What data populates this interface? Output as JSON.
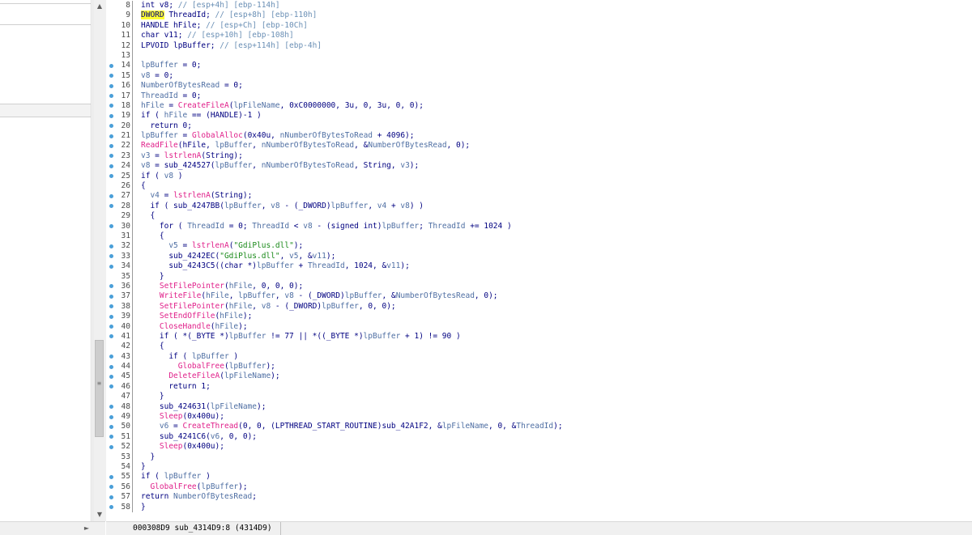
{
  "left_scrollbar": {
    "up_arrow": "▲",
    "down_arrow": "▼",
    "grip": "≡"
  },
  "bottom_left": {
    "right_arrow": "►"
  },
  "status_bar": {
    "text": "000308D9 sub_4314D9:8 (4314D9)"
  },
  "colors": {
    "keyword": "#000080",
    "comment": "#6a8fb5",
    "api": "#e0208a",
    "variable": "#4f6fa3",
    "string": "#1a8a1a",
    "highlight": "#ffff33",
    "dot": "#4a9fd8"
  },
  "code_lines": [
    {
      "n": "8",
      "dot": false,
      "parts": [
        [
          "kw",
          "int v8; "
        ],
        [
          "cm",
          "// [esp+4h] [ebp-114h]"
        ]
      ]
    },
    {
      "n": "9",
      "dot": false,
      "parts": [
        [
          "hl",
          "DWORD"
        ],
        [
          "kw",
          " ThreadId; "
        ],
        [
          "cm",
          "// [esp+8h] [ebp-110h]"
        ]
      ]
    },
    {
      "n": "10",
      "dot": false,
      "parts": [
        [
          "kw",
          "HANDLE hFile; "
        ],
        [
          "cm",
          "// [esp+Ch] [ebp-10Ch]"
        ]
      ]
    },
    {
      "n": "11",
      "dot": false,
      "parts": [
        [
          "kw",
          "char v11; "
        ],
        [
          "cm",
          "// [esp+10h] [ebp-108h]"
        ]
      ]
    },
    {
      "n": "12",
      "dot": false,
      "parts": [
        [
          "kw",
          "LPVOID lpBuffer; "
        ],
        [
          "cm",
          "// [esp+114h] [ebp-4h]"
        ]
      ]
    },
    {
      "n": "13",
      "dot": false,
      "parts": []
    },
    {
      "n": "14",
      "dot": true,
      "parts": [
        [
          "var",
          "lpBuffer"
        ],
        [
          "kw",
          " = 0;"
        ]
      ]
    },
    {
      "n": "15",
      "dot": true,
      "parts": [
        [
          "var",
          "v8"
        ],
        [
          "kw",
          " = 0;"
        ]
      ]
    },
    {
      "n": "16",
      "dot": true,
      "parts": [
        [
          "var",
          "NumberOfBytesRead"
        ],
        [
          "kw",
          " = 0;"
        ]
      ]
    },
    {
      "n": "17",
      "dot": true,
      "parts": [
        [
          "var",
          "ThreadId"
        ],
        [
          "kw",
          " = 0;"
        ]
      ]
    },
    {
      "n": "18",
      "dot": true,
      "parts": [
        [
          "var",
          "hFile"
        ],
        [
          "kw",
          " = "
        ],
        [
          "fn",
          "CreateFileA"
        ],
        [
          "kw",
          "("
        ],
        [
          "var",
          "lpFileName"
        ],
        [
          "kw",
          ", 0xC0000000, 3u, 0, 3u, 0, 0);"
        ]
      ]
    },
    {
      "n": "19",
      "dot": true,
      "parts": [
        [
          "kw",
          "if ( "
        ],
        [
          "var",
          "hFile"
        ],
        [
          "kw",
          " == (HANDLE)-1 )"
        ]
      ]
    },
    {
      "n": "20",
      "dot": true,
      "parts": [
        [
          "kw",
          "  return 0;"
        ]
      ]
    },
    {
      "n": "21",
      "dot": true,
      "parts": [
        [
          "var",
          "lpBuffer"
        ],
        [
          "kw",
          " = "
        ],
        [
          "fn",
          "GlobalAlloc"
        ],
        [
          "kw",
          "(0x40u, "
        ],
        [
          "var",
          "nNumberOfBytesToRead"
        ],
        [
          "kw",
          " + 4096);"
        ]
      ]
    },
    {
      "n": "22",
      "dot": true,
      "parts": [
        [
          "fn",
          "ReadFile"
        ],
        [
          "kw",
          "(hFile, "
        ],
        [
          "var",
          "lpBuffer"
        ],
        [
          "kw",
          ", "
        ],
        [
          "var",
          "nNumberOfBytesToRead"
        ],
        [
          "kw",
          ", &"
        ],
        [
          "var",
          "NumberOfBytesRead"
        ],
        [
          "kw",
          ", 0);"
        ]
      ]
    },
    {
      "n": "23",
      "dot": true,
      "parts": [
        [
          "var",
          "v3"
        ],
        [
          "kw",
          " = "
        ],
        [
          "fn",
          "lstrlenA"
        ],
        [
          "kw",
          "(String);"
        ]
      ]
    },
    {
      "n": "24",
      "dot": true,
      "parts": [
        [
          "var",
          "v8"
        ],
        [
          "kw",
          " = sub_424527("
        ],
        [
          "var",
          "lpBuffer"
        ],
        [
          "kw",
          ", "
        ],
        [
          "var",
          "nNumberOfBytesToRead"
        ],
        [
          "kw",
          ", String, "
        ],
        [
          "var",
          "v3"
        ],
        [
          "kw",
          ");"
        ]
      ]
    },
    {
      "n": "25",
      "dot": true,
      "parts": [
        [
          "kw",
          "if ( "
        ],
        [
          "var",
          "v8"
        ],
        [
          "kw",
          " )"
        ]
      ]
    },
    {
      "n": "26",
      "dot": false,
      "parts": [
        [
          "kw",
          "{"
        ]
      ]
    },
    {
      "n": "27",
      "dot": true,
      "parts": [
        [
          "var",
          "  v4"
        ],
        [
          "kw",
          " = "
        ],
        [
          "fn",
          "lstrlenA"
        ],
        [
          "kw",
          "(String);"
        ]
      ]
    },
    {
      "n": "28",
      "dot": true,
      "parts": [
        [
          "kw",
          "  if ( sub_4247BB("
        ],
        [
          "var",
          "lpBuffer"
        ],
        [
          "kw",
          ", "
        ],
        [
          "var",
          "v8"
        ],
        [
          "kw",
          " - (_DWORD)"
        ],
        [
          "var",
          "lpBuffer"
        ],
        [
          "kw",
          ", "
        ],
        [
          "var",
          "v4"
        ],
        [
          "kw",
          " + "
        ],
        [
          "var",
          "v8"
        ],
        [
          "kw",
          ") )"
        ]
      ]
    },
    {
      "n": "29",
      "dot": false,
      "parts": [
        [
          "kw",
          "  {"
        ]
      ]
    },
    {
      "n": "30",
      "dot": true,
      "parts": [
        [
          "kw",
          "    for ( "
        ],
        [
          "var",
          "ThreadId"
        ],
        [
          "kw",
          " = 0; "
        ],
        [
          "var",
          "ThreadId"
        ],
        [
          "kw",
          " < "
        ],
        [
          "var",
          "v8"
        ],
        [
          "kw",
          " - (signed int)"
        ],
        [
          "var",
          "lpBuffer"
        ],
        [
          "kw",
          "; "
        ],
        [
          "var",
          "ThreadId"
        ],
        [
          "kw",
          " += 1024 )"
        ]
      ]
    },
    {
      "n": "31",
      "dot": false,
      "parts": [
        [
          "kw",
          "    {"
        ]
      ]
    },
    {
      "n": "32",
      "dot": true,
      "parts": [
        [
          "var",
          "      v5"
        ],
        [
          "kw",
          " = "
        ],
        [
          "fn",
          "lstrlenA"
        ],
        [
          "kw",
          "("
        ],
        [
          "str",
          "\"GdiPlus.dll\""
        ],
        [
          "kw",
          ");"
        ]
      ]
    },
    {
      "n": "33",
      "dot": true,
      "parts": [
        [
          "kw",
          "      sub_4242EC("
        ],
        [
          "str",
          "\"GdiPlus.dll\""
        ],
        [
          "kw",
          ", "
        ],
        [
          "var",
          "v5"
        ],
        [
          "kw",
          ", &"
        ],
        [
          "var",
          "v11"
        ],
        [
          "kw",
          ");"
        ]
      ]
    },
    {
      "n": "34",
      "dot": true,
      "parts": [
        [
          "kw",
          "      sub_4243C5((char *)"
        ],
        [
          "var",
          "lpBuffer"
        ],
        [
          "kw",
          " + "
        ],
        [
          "var",
          "ThreadId"
        ],
        [
          "kw",
          ", 1024, &"
        ],
        [
          "var",
          "v11"
        ],
        [
          "kw",
          ");"
        ]
      ]
    },
    {
      "n": "35",
      "dot": false,
      "parts": [
        [
          "kw",
          "    }"
        ]
      ]
    },
    {
      "n": "36",
      "dot": true,
      "parts": [
        [
          "fn",
          "    SetFilePointer"
        ],
        [
          "kw",
          "("
        ],
        [
          "var",
          "hFile"
        ],
        [
          "kw",
          ", 0, 0, 0);"
        ]
      ]
    },
    {
      "n": "37",
      "dot": true,
      "parts": [
        [
          "fn",
          "    WriteFile"
        ],
        [
          "kw",
          "("
        ],
        [
          "var",
          "hFile"
        ],
        [
          "kw",
          ", "
        ],
        [
          "var",
          "lpBuffer"
        ],
        [
          "kw",
          ", "
        ],
        [
          "var",
          "v8"
        ],
        [
          "kw",
          " - (_DWORD)"
        ],
        [
          "var",
          "lpBuffer"
        ],
        [
          "kw",
          ", &"
        ],
        [
          "var",
          "NumberOfBytesRead"
        ],
        [
          "kw",
          ", 0);"
        ]
      ]
    },
    {
      "n": "38",
      "dot": true,
      "parts": [
        [
          "fn",
          "    SetFilePointer"
        ],
        [
          "kw",
          "("
        ],
        [
          "var",
          "hFile"
        ],
        [
          "kw",
          ", "
        ],
        [
          "var",
          "v8"
        ],
        [
          "kw",
          " - (_DWORD)"
        ],
        [
          "var",
          "lpBuffer"
        ],
        [
          "kw",
          ", 0, 0);"
        ]
      ]
    },
    {
      "n": "39",
      "dot": true,
      "parts": [
        [
          "fn",
          "    SetEndOfFile"
        ],
        [
          "kw",
          "("
        ],
        [
          "var",
          "hFile"
        ],
        [
          "kw",
          ");"
        ]
      ]
    },
    {
      "n": "40",
      "dot": true,
      "parts": [
        [
          "fn",
          "    CloseHandle"
        ],
        [
          "kw",
          "("
        ],
        [
          "var",
          "hFile"
        ],
        [
          "kw",
          ");"
        ]
      ]
    },
    {
      "n": "41",
      "dot": true,
      "parts": [
        [
          "kw",
          "    if ( *(_BYTE *)"
        ],
        [
          "var",
          "lpBuffer"
        ],
        [
          "kw",
          " != 77 || *((_BYTE *)"
        ],
        [
          "var",
          "lpBuffer"
        ],
        [
          "kw",
          " + 1) != 90 )"
        ]
      ]
    },
    {
      "n": "42",
      "dot": false,
      "parts": [
        [
          "kw",
          "    {"
        ]
      ]
    },
    {
      "n": "43",
      "dot": true,
      "parts": [
        [
          "kw",
          "      if ( "
        ],
        [
          "var",
          "lpBuffer"
        ],
        [
          "kw",
          " )"
        ]
      ]
    },
    {
      "n": "44",
      "dot": true,
      "parts": [
        [
          "fn",
          "        GlobalFree"
        ],
        [
          "kw",
          "("
        ],
        [
          "var",
          "lpBuffer"
        ],
        [
          "kw",
          ");"
        ]
      ]
    },
    {
      "n": "45",
      "dot": true,
      "parts": [
        [
          "fn",
          "      DeleteFileA"
        ],
        [
          "kw",
          "("
        ],
        [
          "var",
          "lpFileName"
        ],
        [
          "kw",
          ");"
        ]
      ]
    },
    {
      "n": "46",
      "dot": true,
      "parts": [
        [
          "kw",
          "      return 1;"
        ]
      ]
    },
    {
      "n": "47",
      "dot": false,
      "parts": [
        [
          "kw",
          "    }"
        ]
      ]
    },
    {
      "n": "48",
      "dot": true,
      "parts": [
        [
          "kw",
          "    sub_424631("
        ],
        [
          "var",
          "lpFileName"
        ],
        [
          "kw",
          ");"
        ]
      ]
    },
    {
      "n": "49",
      "dot": true,
      "parts": [
        [
          "fn",
          "    Sleep"
        ],
        [
          "kw",
          "(0x400u);"
        ]
      ]
    },
    {
      "n": "50",
      "dot": true,
      "parts": [
        [
          "var",
          "    v6"
        ],
        [
          "kw",
          " = "
        ],
        [
          "fn",
          "CreateThread"
        ],
        [
          "kw",
          "(0, 0, (LPTHREAD_START_ROUTINE)sub_42A1F2, &"
        ],
        [
          "var",
          "lpFileName"
        ],
        [
          "kw",
          ", 0, &"
        ],
        [
          "var",
          "ThreadId"
        ],
        [
          "kw",
          ");"
        ]
      ]
    },
    {
      "n": "51",
      "dot": true,
      "parts": [
        [
          "kw",
          "    sub_4241C6("
        ],
        [
          "var",
          "v6"
        ],
        [
          "kw",
          ", 0, 0);"
        ]
      ]
    },
    {
      "n": "52",
      "dot": true,
      "parts": [
        [
          "fn",
          "    Sleep"
        ],
        [
          "kw",
          "(0x400u);"
        ]
      ]
    },
    {
      "n": "53",
      "dot": false,
      "parts": [
        [
          "kw",
          "  }"
        ]
      ]
    },
    {
      "n": "54",
      "dot": false,
      "parts": [
        [
          "kw",
          "}"
        ]
      ]
    },
    {
      "n": "55",
      "dot": true,
      "parts": [
        [
          "kw",
          "if ( "
        ],
        [
          "var",
          "lpBuffer"
        ],
        [
          "kw",
          " )"
        ]
      ]
    },
    {
      "n": "56",
      "dot": true,
      "parts": [
        [
          "fn",
          "  GlobalFree"
        ],
        [
          "kw",
          "("
        ],
        [
          "var",
          "lpBuffer"
        ],
        [
          "kw",
          ");"
        ]
      ]
    },
    {
      "n": "57",
      "dot": true,
      "parts": [
        [
          "kw",
          "return "
        ],
        [
          "var",
          "NumberOfBytesRead"
        ],
        [
          "kw",
          ";"
        ]
      ]
    },
    {
      "n": "58",
      "dot": true,
      "parts": [
        [
          "kw",
          "}"
        ]
      ]
    }
  ]
}
